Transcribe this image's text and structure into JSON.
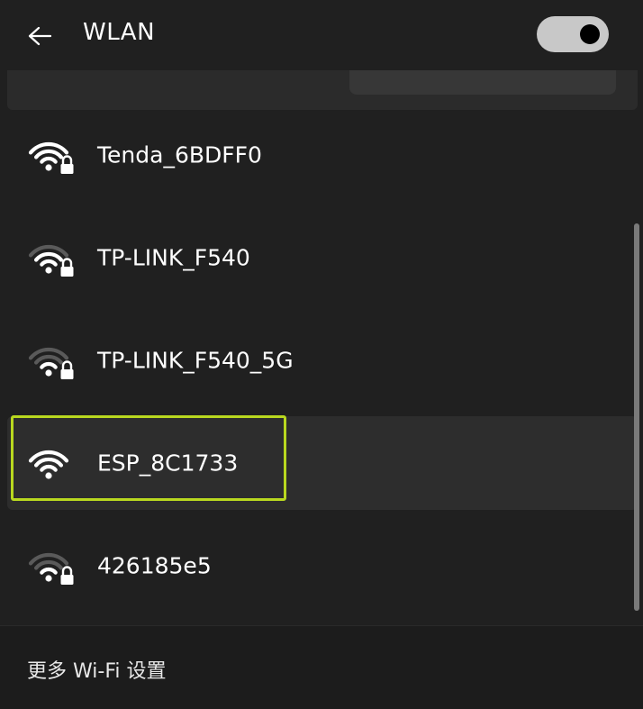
{
  "header": {
    "back_icon": "arrow-left-icon",
    "title": "WLAN",
    "wifi_enabled": true
  },
  "networks": [
    {
      "ssid": "Tenda_6BDFF0",
      "signal_bars": 4,
      "secured": true,
      "selected": false
    },
    {
      "ssid": "TP-LINK_F540",
      "signal_bars": 3,
      "secured": true,
      "selected": false
    },
    {
      "ssid": "TP-LINK_F540_5G",
      "signal_bars": 2,
      "secured": true,
      "selected": false
    },
    {
      "ssid": "ESP_8C1733",
      "signal_bars": 4,
      "secured": false,
      "selected": true
    },
    {
      "ssid": "426185e5",
      "signal_bars": 2,
      "secured": true,
      "selected": false
    }
  ],
  "footer": {
    "more_settings_label": "更多 Wi-Fi 设置"
  },
  "colors": {
    "background": "#202020",
    "selected_row": "#2d2d2d",
    "highlight_border": "#b9d81f",
    "toggle_track": "#c8c8c8",
    "toggle_knob": "#000000"
  }
}
